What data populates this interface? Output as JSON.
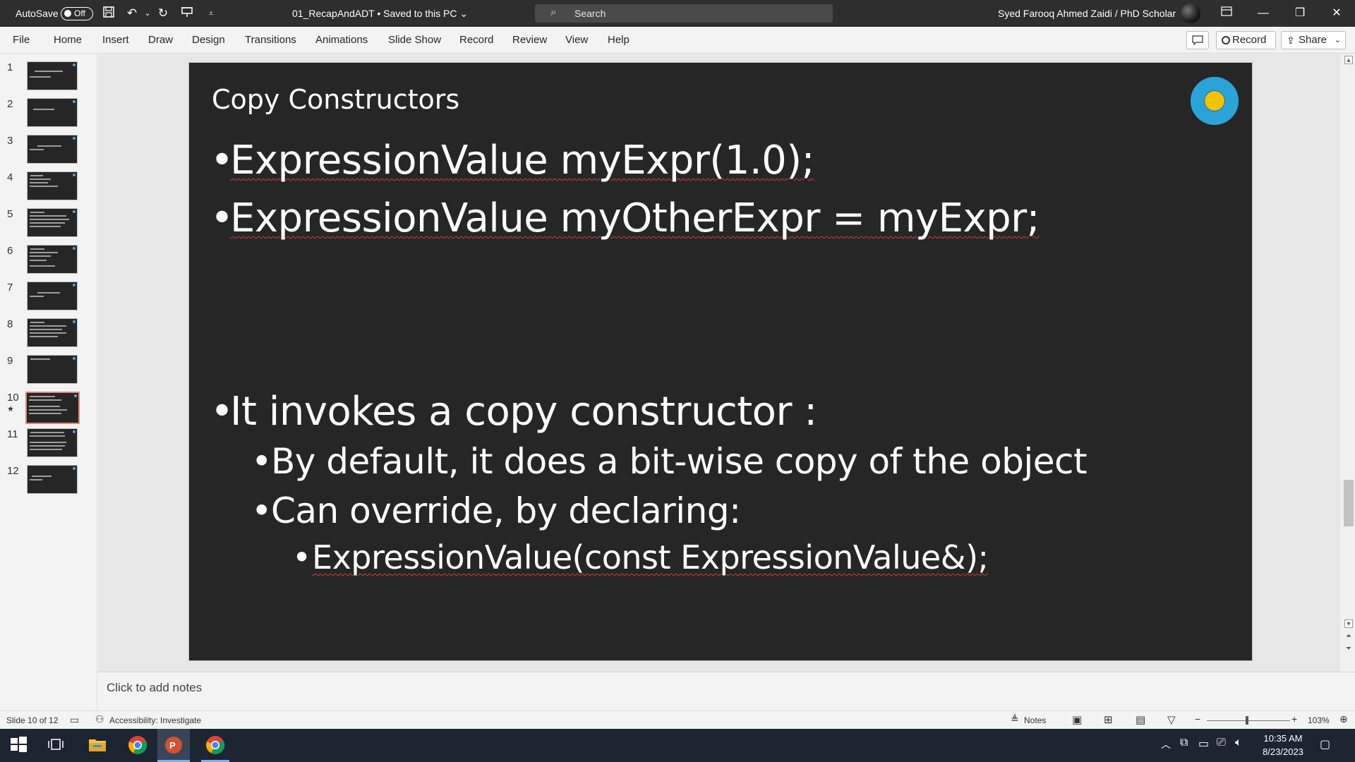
{
  "titlebar": {
    "autosave_label": "AutoSave",
    "autosave_state": "Off",
    "document": "01_RecapAndADT • Saved to this PC ⌄",
    "search_placeholder": "Search",
    "user": "Syed Farooq Ahmed Zaidi / PhD Scholar"
  },
  "ribbon": {
    "tabs": [
      "File",
      "Home",
      "Insert",
      "Draw",
      "Design",
      "Transitions",
      "Animations",
      "Slide Show",
      "Record",
      "Review",
      "View",
      "Help"
    ],
    "record_label": "Record",
    "share_label": "Share"
  },
  "thumbnails": {
    "numbers": [
      "1",
      "2",
      "3",
      "4",
      "5",
      "6",
      "7",
      "8",
      "9",
      "10",
      "11",
      "12"
    ],
    "active_index": 10
  },
  "slide": {
    "title": "Copy Constructors",
    "bullets": [
      {
        "level": 1,
        "text": "ExpressionValue myExpr(1.0);"
      },
      {
        "level": 1,
        "text": "ExpressionValue myOtherExpr = myExpr;"
      },
      {
        "level": 1,
        "text": "It invokes a copy constructor :"
      },
      {
        "level": 2,
        "text": "By default, it does a bit-wise copy of the object"
      },
      {
        "level": 2,
        "text": "Can override, by declaring:"
      },
      {
        "level": 3,
        "text": "ExpressionValue(const ExpressionValue&);"
      }
    ]
  },
  "notes": {
    "placeholder": "Click to add notes"
  },
  "status": {
    "slide_info": "Slide 10 of 12",
    "accessibility": "Accessibility: Investigate",
    "notes_label": "Notes",
    "zoom": "103%"
  },
  "taskbar": {
    "time": "10:35 AM",
    "date": "8/23/2023"
  },
  "colors": {
    "titlebar": "#2e2e2e",
    "slide_bg": "#262626",
    "active_thumb_border": "#e8846e",
    "taskbar": "#1d2533"
  }
}
